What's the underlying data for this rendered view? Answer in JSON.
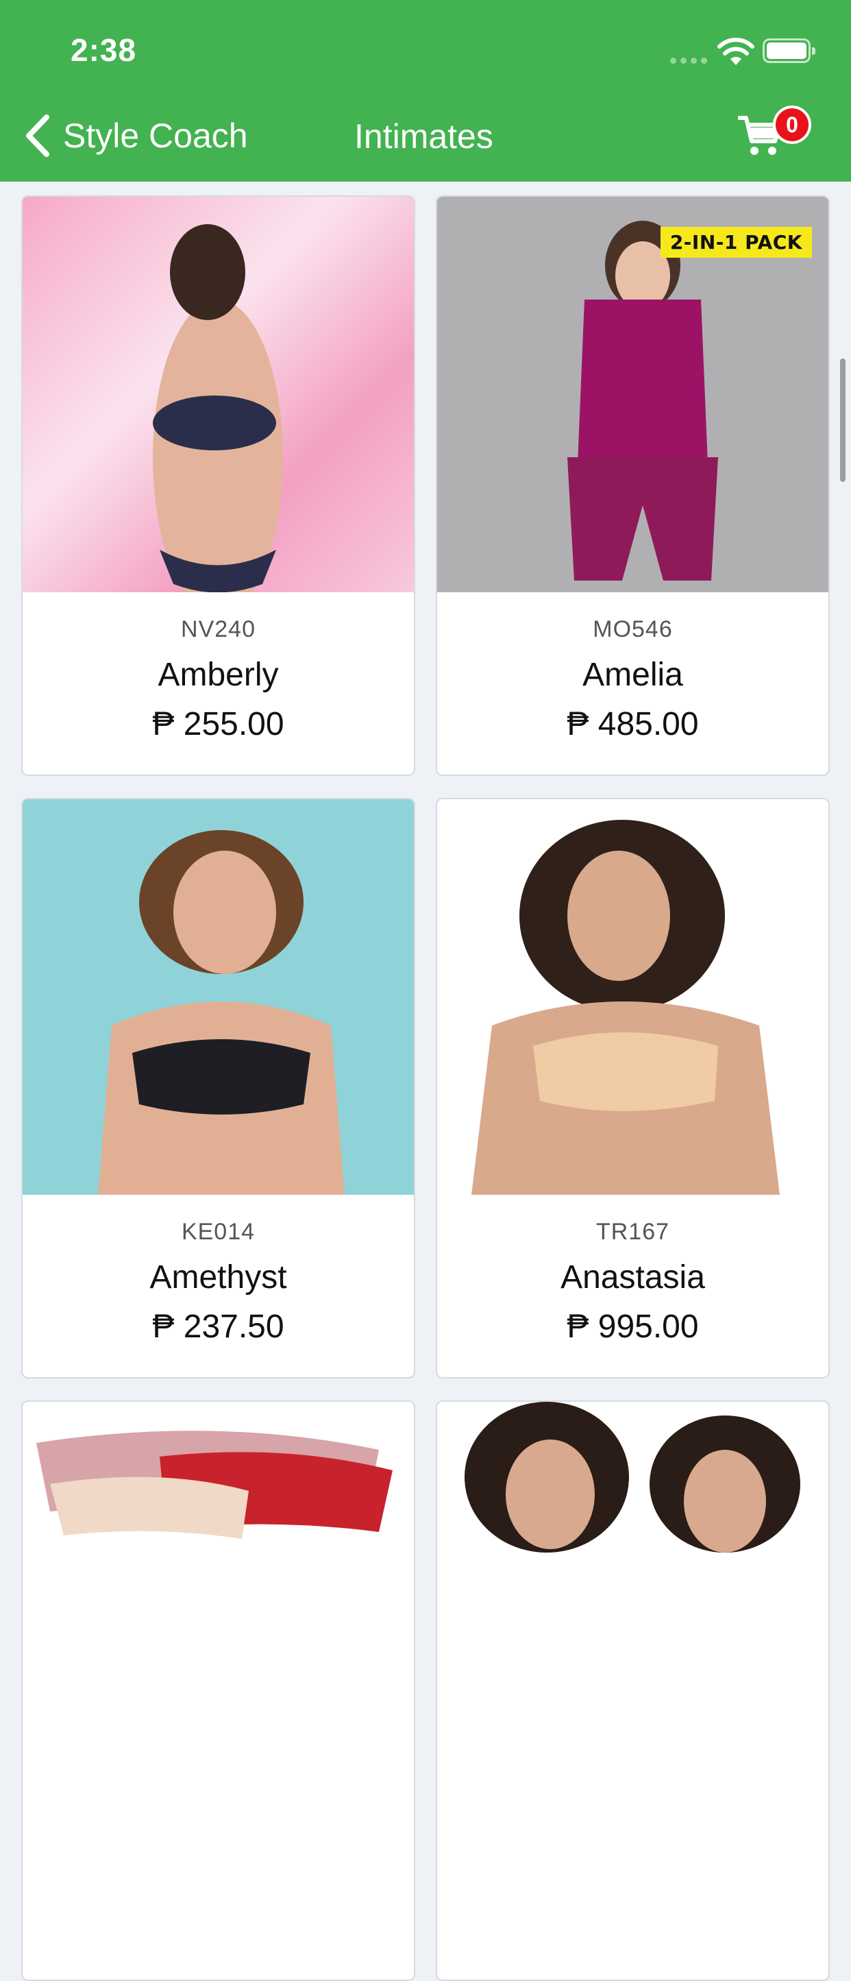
{
  "status_bar": {
    "time": "2:38"
  },
  "nav": {
    "back_label": "Style Coach",
    "title": "Intimates",
    "cart_count": "0"
  },
  "products": [
    {
      "code": "NV240",
      "name": "Amberly",
      "price": "₱ 255.00",
      "badge": ""
    },
    {
      "code": "MO546",
      "name": "Amelia",
      "price": "₱ 485.00",
      "badge": "2-IN-1 PACK"
    },
    {
      "code": "KE014",
      "name": "Amethyst",
      "price": "₱ 237.50",
      "badge": ""
    },
    {
      "code": "TR167",
      "name": "Anastasia",
      "price": "₱ 995.00",
      "badge": ""
    },
    {
      "code": "",
      "name": "",
      "price": "",
      "badge": ""
    },
    {
      "code": "",
      "name": "",
      "price": "",
      "badge": ""
    }
  ],
  "colors": {
    "header_green": "#43b250",
    "badge_red": "#e8131a",
    "pack_yellow": "#f6e91b"
  }
}
